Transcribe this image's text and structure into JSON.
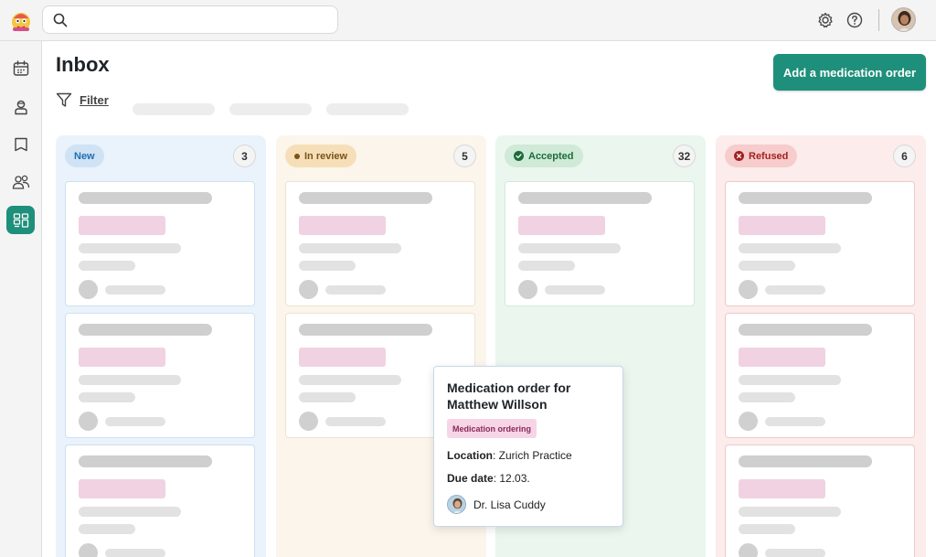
{
  "search": {
    "placeholder": ""
  },
  "main": {
    "title": "Inbox",
    "filter_label": "Filter",
    "add_button": "Add a medication order"
  },
  "columns": [
    {
      "label": "New",
      "count": "3",
      "color": "#1f6fb0",
      "badge_bg": "#cfe3f5"
    },
    {
      "label": "In review",
      "count": "5",
      "color": "#7a5418",
      "badge_bg": "#f6dfb8"
    },
    {
      "label": "Accepted",
      "count": "32",
      "color": "#1b6b3a",
      "badge_bg": "#cfead7"
    },
    {
      "label": "Refused",
      "count": "6",
      "color": "#a32121",
      "badge_bg": "#f7cccc"
    }
  ],
  "popup": {
    "title": "Medication order for Matthew Willson",
    "tag": "Medication ordering",
    "location_label": "Location",
    "location_value": "Zurich Practice",
    "due_label": "Due date",
    "due_value": "12.03.",
    "doctor": "Dr. Lisa Cuddy"
  },
  "colors": {
    "accent": "#1e8f7a",
    "new": "#eaf3fb",
    "in_review": "#fbf5ec",
    "accepted": "#eaf6ee",
    "refused": "#fcecec"
  }
}
